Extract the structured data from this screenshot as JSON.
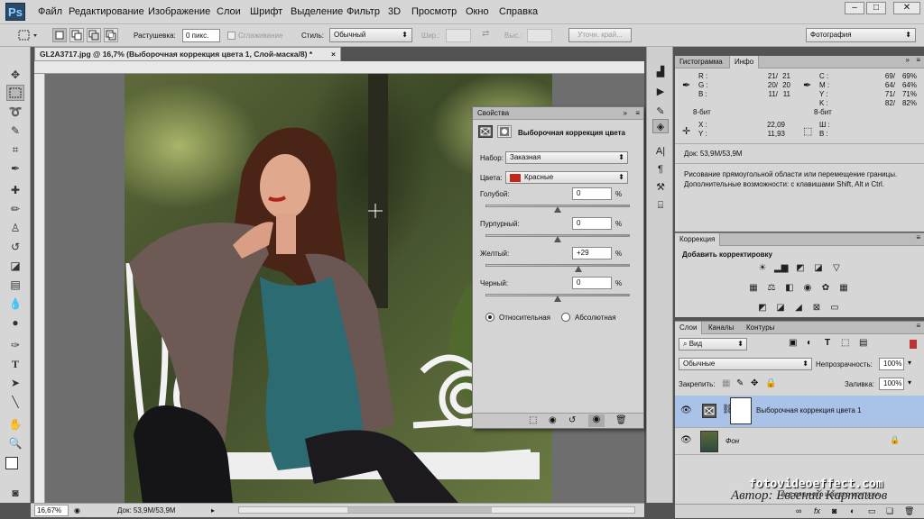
{
  "app": {
    "logo": "Ps"
  },
  "menu": [
    "Файл",
    "Редактирование",
    "Изображение",
    "Слои",
    "Шрифт",
    "Выделение",
    "Фильтр",
    "3D",
    "Просмотр",
    "Окно",
    "Справка"
  ],
  "window_controls": {
    "minimize": "–",
    "maximize": "□",
    "close": "✕"
  },
  "options": {
    "feather_label": "Растушевка:",
    "feather_value": "0 пикс.",
    "antialias_label": "Сглаживание",
    "style_label": "Стиль:",
    "style_value": "Обычный",
    "width_label": "Шир.:",
    "height_label": "Выс.:",
    "refine_label": "Уточн. край...",
    "workspace_value": "Фотография"
  },
  "document": {
    "tab_title": "GL2A3717.jpg @ 16,7% (Выборочная коррекция цвета 1, Слой-маска/8) *",
    "close": "×"
  },
  "status": {
    "zoom": "16,67%",
    "doc": "Док: 53,9М/53,9М"
  },
  "properties": {
    "tab": "Свойства",
    "title": "Выборочная коррекция цвета",
    "preset_label": "Набор:",
    "preset_value": "Заказная",
    "colors_label": "Цвета:",
    "colors_value": "Красные",
    "color_swatch": "#c0281c",
    "sliders": [
      {
        "label": "Голубой:",
        "value": "0",
        "unit": "%",
        "pos": 0.5
      },
      {
        "label": "Пурпурный:",
        "value": "0",
        "unit": "%",
        "pos": 0.5
      },
      {
        "label": "Желтый:",
        "value": "+29",
        "unit": "%",
        "pos": 0.645
      },
      {
        "label": "Черный:",
        "value": "0",
        "unit": "%",
        "pos": 0.5
      }
    ],
    "mode_relative": "Относительная",
    "mode_absolute": "Абсолютная"
  },
  "info_panel": {
    "tabs": [
      "Гистограмма",
      "Инфо"
    ],
    "rgb_labels": [
      "R :",
      "G :",
      "B :"
    ],
    "rgb_values_a": [
      "21/",
      "20/",
      "11/"
    ],
    "rgb_values_b": [
      "21",
      "20",
      "11"
    ],
    "cmyk_labels": [
      "C :",
      "M :",
      "Y :",
      "K :"
    ],
    "cmyk_values_a": [
      "69/",
      "64/",
      "71/",
      "82/"
    ],
    "cmyk_values_b": [
      "69%",
      "64%",
      "71%",
      "82%"
    ],
    "bits_left": "8-бит",
    "bits_right": "8-бит",
    "xy_labels": [
      "X :",
      "Y :"
    ],
    "xy_values": [
      "22,09",
      "11,93"
    ],
    "wh_labels": [
      "Ш :",
      "В :"
    ],
    "doc": "Док: 53,9М/53,9М",
    "hint": "Рисование прямоугольной области или перемещение границы. Дополнительные возможности: с клавишами Shift, Alt и Ctrl."
  },
  "adjustments": {
    "tab": "Коррекция",
    "title": "Добавить корректировку"
  },
  "layers": {
    "tabs": [
      "Слои",
      "Каналы",
      "Контуры"
    ],
    "filter_value": "Вид",
    "blend_value": "Обычные",
    "opacity_label": "Непрозрачность:",
    "opacity_value": "100%",
    "lock_label": "Закрепить:",
    "fill_label": "Заливка:",
    "fill_value": "100%",
    "items": [
      {
        "name": "Выборочная коррекция цвета 1"
      },
      {
        "name": "Фон"
      }
    ]
  },
  "watermark": {
    "site": "fotovideoeffect.com",
    "tagline": "ВСЕ ДЛЯ ФОТО И ВИДЕО МОНТАЖА",
    "author": "Автор: Евгений Карташов"
  }
}
